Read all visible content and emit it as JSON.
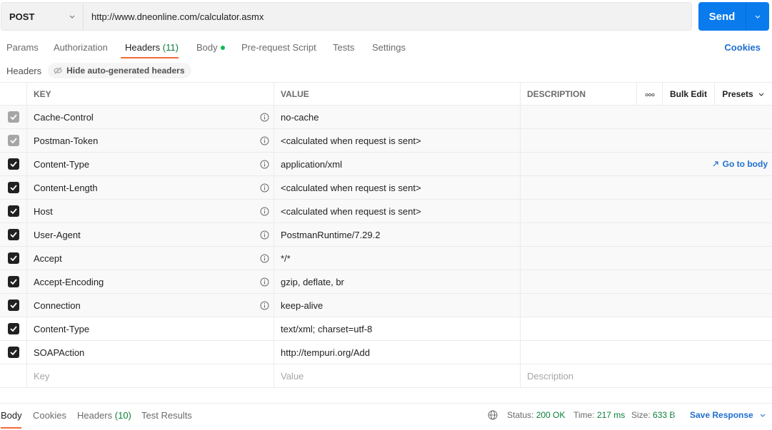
{
  "request": {
    "method": "POST",
    "url": "http://www.dneonline.com/calculator.asmx",
    "send_label": "Send"
  },
  "tabs": [
    {
      "label": "Params"
    },
    {
      "label": "Authorization"
    },
    {
      "label": "Headers",
      "count": "(11)",
      "active": true
    },
    {
      "label": "Body",
      "has_dot": true
    },
    {
      "label": "Pre-request Script"
    },
    {
      "label": "Tests"
    },
    {
      "label": "Settings"
    }
  ],
  "cookies_label": "Cookies",
  "headers_section": {
    "title": "Headers",
    "toggle_label": "Hide auto-generated headers"
  },
  "table": {
    "columns": {
      "key": "KEY",
      "value": "VALUE",
      "description": "DESCRIPTION"
    },
    "more_icon": "ellipsis-icon",
    "bulk_edit_label": "Bulk Edit",
    "presets_label": "Presets",
    "goto_body_label": "Go to body",
    "rows": [
      {
        "key": "Cache-Control",
        "value": "no-cache",
        "checked": true,
        "auto": true,
        "locked": true
      },
      {
        "key": "Postman-Token",
        "value": "<calculated when request is sent>",
        "checked": true,
        "auto": true,
        "locked": true
      },
      {
        "key": "Content-Type",
        "value": "application/xml",
        "checked": true,
        "auto": true
      },
      {
        "key": "Content-Length",
        "value": "<calculated when request is sent>",
        "checked": true,
        "auto": true
      },
      {
        "key": "Host",
        "value": "<calculated when request is sent>",
        "checked": true,
        "auto": true
      },
      {
        "key": "User-Agent",
        "value": "PostmanRuntime/7.29.2",
        "checked": true,
        "auto": true
      },
      {
        "key": "Accept",
        "value": "*/*",
        "checked": true,
        "auto": true
      },
      {
        "key": "Accept-Encoding",
        "value": "gzip, deflate, br",
        "checked": true,
        "auto": true
      },
      {
        "key": "Connection",
        "value": "keep-alive",
        "checked": true,
        "auto": true
      },
      {
        "key": "Content-Type",
        "value": "text/xml; charset=utf-8",
        "checked": true,
        "auto": false
      },
      {
        "key": "SOAPAction",
        "value": "http://tempuri.org/Add",
        "checked": true,
        "auto": false
      }
    ],
    "placeholders": {
      "key": "Key",
      "value": "Value",
      "description": "Description"
    }
  },
  "response": {
    "tabs": [
      {
        "label": "Body",
        "active": true
      },
      {
        "label": "Cookies"
      },
      {
        "label": "Headers",
        "count": "(10)"
      },
      {
        "label": "Test Results"
      }
    ],
    "status_label": "Status:",
    "status_value": "200 OK",
    "time_label": "Time:",
    "time_value": "217 ms",
    "size_label": "Size:",
    "size_value": "633 B",
    "save_label": "Save Response"
  },
  "colors": {
    "accent": "#097bed",
    "tab_underline": "#f26b3a",
    "success": "#0a7f3a",
    "link": "#1f6fd0"
  }
}
